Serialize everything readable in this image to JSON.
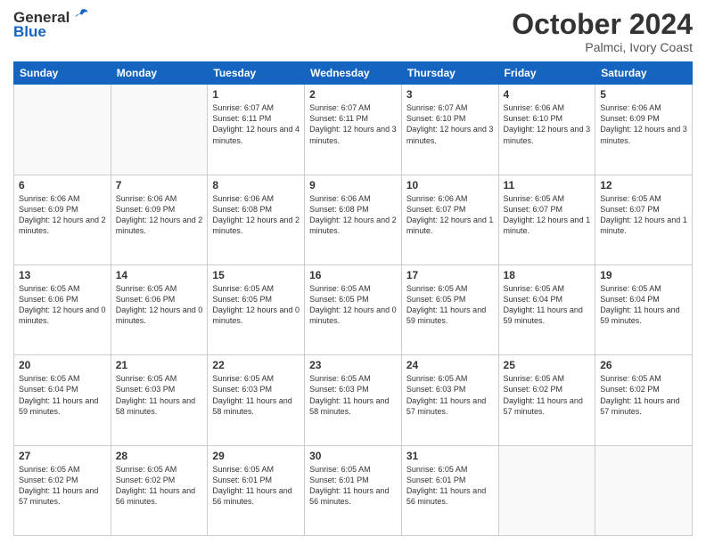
{
  "header": {
    "logo_general": "General",
    "logo_blue": "Blue",
    "month": "October 2024",
    "location": "Palmci, Ivory Coast"
  },
  "weekdays": [
    "Sunday",
    "Monday",
    "Tuesday",
    "Wednesday",
    "Thursday",
    "Friday",
    "Saturday"
  ],
  "weeks": [
    [
      {
        "day": "",
        "info": ""
      },
      {
        "day": "",
        "info": ""
      },
      {
        "day": "1",
        "info": "Sunrise: 6:07 AM\nSunset: 6:11 PM\nDaylight: 12 hours\nand 4 minutes."
      },
      {
        "day": "2",
        "info": "Sunrise: 6:07 AM\nSunset: 6:11 PM\nDaylight: 12 hours\nand 3 minutes."
      },
      {
        "day": "3",
        "info": "Sunrise: 6:07 AM\nSunset: 6:10 PM\nDaylight: 12 hours\nand 3 minutes."
      },
      {
        "day": "4",
        "info": "Sunrise: 6:06 AM\nSunset: 6:10 PM\nDaylight: 12 hours\nand 3 minutes."
      },
      {
        "day": "5",
        "info": "Sunrise: 6:06 AM\nSunset: 6:09 PM\nDaylight: 12 hours\nand 3 minutes."
      }
    ],
    [
      {
        "day": "6",
        "info": "Sunrise: 6:06 AM\nSunset: 6:09 PM\nDaylight: 12 hours\nand 2 minutes."
      },
      {
        "day": "7",
        "info": "Sunrise: 6:06 AM\nSunset: 6:09 PM\nDaylight: 12 hours\nand 2 minutes."
      },
      {
        "day": "8",
        "info": "Sunrise: 6:06 AM\nSunset: 6:08 PM\nDaylight: 12 hours\nand 2 minutes."
      },
      {
        "day": "9",
        "info": "Sunrise: 6:06 AM\nSunset: 6:08 PM\nDaylight: 12 hours\nand 2 minutes."
      },
      {
        "day": "10",
        "info": "Sunrise: 6:06 AM\nSunset: 6:07 PM\nDaylight: 12 hours\nand 1 minute."
      },
      {
        "day": "11",
        "info": "Sunrise: 6:05 AM\nSunset: 6:07 PM\nDaylight: 12 hours\nand 1 minute."
      },
      {
        "day": "12",
        "info": "Sunrise: 6:05 AM\nSunset: 6:07 PM\nDaylight: 12 hours\nand 1 minute."
      }
    ],
    [
      {
        "day": "13",
        "info": "Sunrise: 6:05 AM\nSunset: 6:06 PM\nDaylight: 12 hours\nand 0 minutes."
      },
      {
        "day": "14",
        "info": "Sunrise: 6:05 AM\nSunset: 6:06 PM\nDaylight: 12 hours\nand 0 minutes."
      },
      {
        "day": "15",
        "info": "Sunrise: 6:05 AM\nSunset: 6:05 PM\nDaylight: 12 hours\nand 0 minutes."
      },
      {
        "day": "16",
        "info": "Sunrise: 6:05 AM\nSunset: 6:05 PM\nDaylight: 12 hours\nand 0 minutes."
      },
      {
        "day": "17",
        "info": "Sunrise: 6:05 AM\nSunset: 6:05 PM\nDaylight: 11 hours\nand 59 minutes."
      },
      {
        "day": "18",
        "info": "Sunrise: 6:05 AM\nSunset: 6:04 PM\nDaylight: 11 hours\nand 59 minutes."
      },
      {
        "day": "19",
        "info": "Sunrise: 6:05 AM\nSunset: 6:04 PM\nDaylight: 11 hours\nand 59 minutes."
      }
    ],
    [
      {
        "day": "20",
        "info": "Sunrise: 6:05 AM\nSunset: 6:04 PM\nDaylight: 11 hours\nand 59 minutes."
      },
      {
        "day": "21",
        "info": "Sunrise: 6:05 AM\nSunset: 6:03 PM\nDaylight: 11 hours\nand 58 minutes."
      },
      {
        "day": "22",
        "info": "Sunrise: 6:05 AM\nSunset: 6:03 PM\nDaylight: 11 hours\nand 58 minutes."
      },
      {
        "day": "23",
        "info": "Sunrise: 6:05 AM\nSunset: 6:03 PM\nDaylight: 11 hours\nand 58 minutes."
      },
      {
        "day": "24",
        "info": "Sunrise: 6:05 AM\nSunset: 6:03 PM\nDaylight: 11 hours\nand 57 minutes."
      },
      {
        "day": "25",
        "info": "Sunrise: 6:05 AM\nSunset: 6:02 PM\nDaylight: 11 hours\nand 57 minutes."
      },
      {
        "day": "26",
        "info": "Sunrise: 6:05 AM\nSunset: 6:02 PM\nDaylight: 11 hours\nand 57 minutes."
      }
    ],
    [
      {
        "day": "27",
        "info": "Sunrise: 6:05 AM\nSunset: 6:02 PM\nDaylight: 11 hours\nand 57 minutes."
      },
      {
        "day": "28",
        "info": "Sunrise: 6:05 AM\nSunset: 6:02 PM\nDaylight: 11 hours\nand 56 minutes."
      },
      {
        "day": "29",
        "info": "Sunrise: 6:05 AM\nSunset: 6:01 PM\nDaylight: 11 hours\nand 56 minutes."
      },
      {
        "day": "30",
        "info": "Sunrise: 6:05 AM\nSunset: 6:01 PM\nDaylight: 11 hours\nand 56 minutes."
      },
      {
        "day": "31",
        "info": "Sunrise: 6:05 AM\nSunset: 6:01 PM\nDaylight: 11 hours\nand 56 minutes."
      },
      {
        "day": "",
        "info": ""
      },
      {
        "day": "",
        "info": ""
      }
    ]
  ]
}
